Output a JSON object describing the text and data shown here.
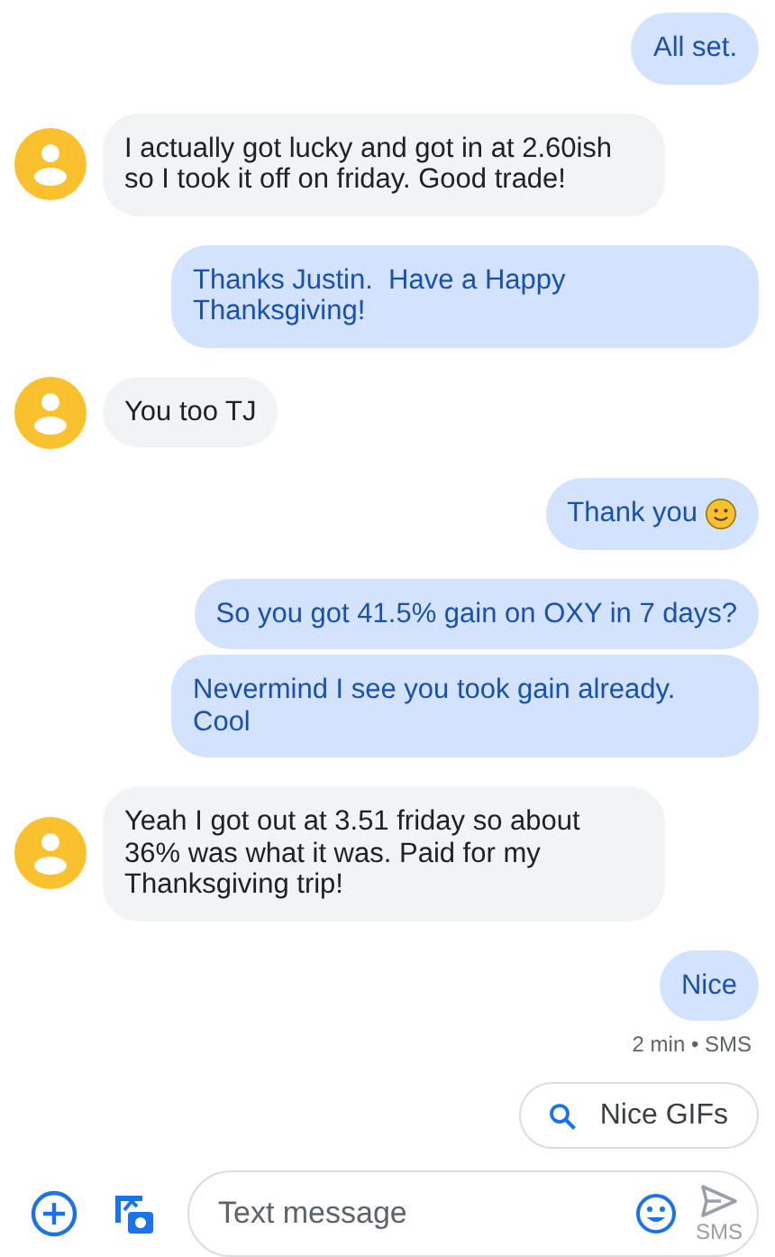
{
  "messages": [
    {
      "kind": "me",
      "text": "All set."
    },
    {
      "kind": "them",
      "text": "I actually got lucky and got in at 2.60ish so I took it off on friday. Good trade!"
    },
    {
      "kind": "me",
      "text": "Thanks Justin.  Have a Happy Thanksgiving!"
    },
    {
      "kind": "them",
      "text": "You too TJ"
    },
    {
      "kind": "me",
      "text": "Thank you",
      "emoji": true
    },
    {
      "kind": "me",
      "text": "So you got 41.5% gain on OXY in 7 days?"
    },
    {
      "kind": "me",
      "text": "Nevermind I see you took gain already. Cool"
    },
    {
      "kind": "them",
      "text": "Yeah I got out at 3.51 friday so about 36% was what it was. Paid for my Thanksgiving trip!"
    },
    {
      "kind": "me",
      "text": "Nice"
    }
  ],
  "status": "2 min • SMS",
  "suggestion": "Nice GIFs",
  "composer": {
    "placeholder": "Text message",
    "send_label": "SMS"
  }
}
